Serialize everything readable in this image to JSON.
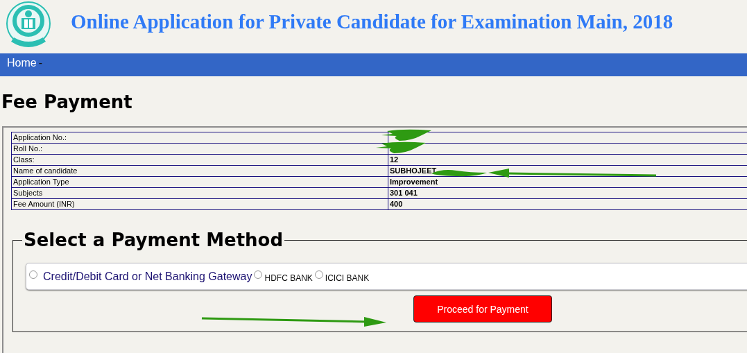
{
  "header": {
    "title": "Online Application for Private Candidate for Examination Main, 2018"
  },
  "nav": [
    {
      "label": "Home",
      "kind": "link"
    },
    {
      "label": "-",
      "kind": "separator"
    }
  ],
  "heading": "Fee Payment",
  "details": [
    {
      "label": "Application No.:",
      "redacted": true
    },
    {
      "label": "Roll No.:",
      "redacted": true
    },
    {
      "label": "Class:",
      "value": "12"
    },
    {
      "label": "Name of candidate",
      "value": "SUBHOJEET",
      "redacted": true
    },
    {
      "label": "Application Type",
      "value": "Improvement"
    },
    {
      "label": "Subjects",
      "value": "301 041"
    },
    {
      "label": "Fee Amount (INR)",
      "value": "400"
    }
  ],
  "payment": {
    "legend": "Select a Payment Method",
    "options": [
      {
        "label": "Credit/Debit Card or Net Banking Gateway",
        "kind": "gateway",
        "selected": false
      },
      {
        "label": "HDFC BANK",
        "kind": "bank",
        "selected": false
      },
      {
        "label": "ICICI BANK",
        "kind": "bank",
        "selected": false
      }
    ],
    "button": "Proceed for Payment"
  }
}
